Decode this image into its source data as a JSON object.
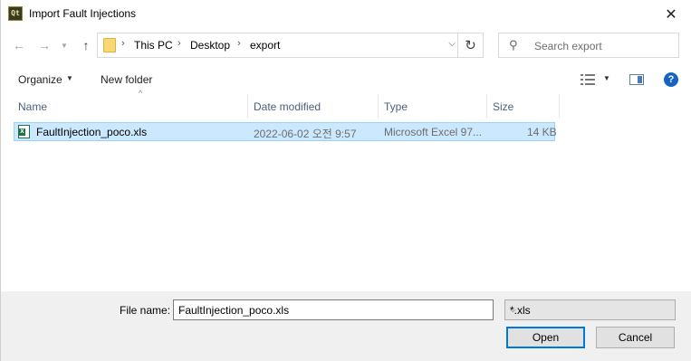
{
  "window": {
    "title": "Import Fault Injections"
  },
  "nav": {
    "breadcrumb": [
      "This PC",
      "Desktop",
      "export"
    ],
    "search_placeholder": "Search export"
  },
  "toolbar": {
    "organize": "Organize",
    "new_folder": "New folder"
  },
  "columns": [
    "Name",
    "Date modified",
    "Type",
    "Size"
  ],
  "files": [
    {
      "name": "FaultInjection_poco.xls",
      "date_modified": "2022-06-02 오전 9:57",
      "type": "Microsoft Excel 97...",
      "size": "14 KB",
      "selected": true
    }
  ],
  "bottom": {
    "file_name_label": "File name:",
    "file_name_value": "FaultInjection_poco.xls",
    "file_type": "*.xls",
    "open_button": "Open",
    "cancel_button": "Cancel"
  },
  "icons": {
    "app": "qt-app-icon",
    "close": "close-icon",
    "back": "arrow-left-icon",
    "forward": "arrow-right-icon",
    "recent": "chevron-down-icon",
    "up": "arrow-up-icon",
    "folder": "folder-icon",
    "refresh": "refresh-icon",
    "search": "search-icon",
    "view": "view-options-icon",
    "preview": "preview-pane-icon",
    "help": "help-icon",
    "file": "excel-file-icon"
  },
  "colors": {
    "selection_bg": "#cce8ff",
    "selection_border": "#99d1ff",
    "accent": "#0078d7",
    "header_text": "#4c607a"
  }
}
